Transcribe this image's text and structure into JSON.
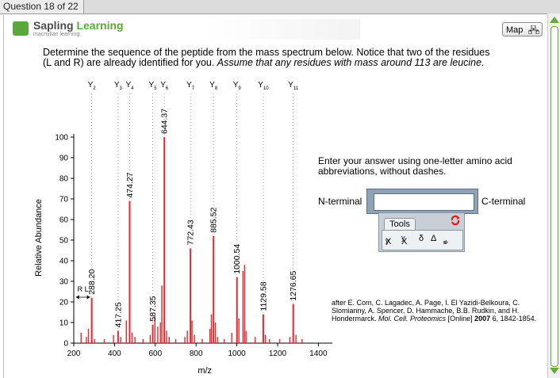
{
  "header": {
    "tab_label": "Question 18 of 22"
  },
  "logo": {
    "brand_part1": "Sapling ",
    "brand_part2": "Learning",
    "subtitle": "macmillan learning"
  },
  "map_button": {
    "label": "Map"
  },
  "prompt": {
    "line1": "Determine the sequence of the peptide from the mass spectrum below. Notice that two of the residues",
    "line2_plain": "(L and R) are already identified for you. ",
    "line2_italic": "Assume that any residues with mass around 113 are leucine."
  },
  "answer": {
    "instructions": "Enter your answer using one-letter amino acid abbreviations, without dashes.",
    "n_terminal_label": "N-terminal",
    "c_terminal_label": "C-terminal",
    "input_value": "",
    "tools_label": "Tools",
    "tool_buttons": [
      "X",
      "y",
      "X",
      "y",
      "δ",
      "Δ",
      "≤",
      "∞"
    ]
  },
  "citation": {
    "text": "after E. Com, C. Lagadec, A. Page, I. El Yazidi-Belkoura, C. Slomianny, A. Spencer, D. Hammache, B.B. Rudkin, and H. Hondermarck. ",
    "journal": "Mol. Cell. Proteomics",
    "rest1": " [Online] ",
    "year": "2007",
    "rest2": " 6, 1842-1854."
  },
  "colors": {
    "peak": "#e8282e",
    "brand_green": "#5aa73b",
    "answer_box": "#8fa3b7"
  },
  "chart_data": {
    "type": "bar",
    "xlabel": "m/z",
    "ylabel": "Relative Abundance",
    "xlim": [
      200,
      1500
    ],
    "ylim": [
      0,
      100
    ],
    "xticks": [
      200,
      400,
      600,
      800,
      1000,
      1200,
      1400
    ],
    "yticks": [
      0,
      10,
      20,
      30,
      40,
      50,
      60,
      70,
      80,
      90,
      100
    ],
    "labeled_peaks": [
      {
        "mz": 288.2,
        "label": "288.20",
        "intensity": 22
      },
      {
        "mz": 417.25,
        "label": "417.25",
        "intensity": 6
      },
      {
        "mz": 474.27,
        "label": "474.27",
        "intensity": 69
      },
      {
        "mz": 587.35,
        "label": "587.35",
        "intensity": 9
      },
      {
        "mz": 644.37,
        "label": "644.37",
        "intensity": 100
      },
      {
        "mz": 772.43,
        "label": "772.43",
        "intensity": 46
      },
      {
        "mz": 885.52,
        "label": "885.52",
        "intensity": 52
      },
      {
        "mz": 1000.54,
        "label": "1000.54",
        "intensity": 32
      },
      {
        "mz": 1129.58,
        "label": "1129.58",
        "intensity": 14
      },
      {
        "mz": 1276.65,
        "label": "1276.65",
        "intensity": 19
      }
    ],
    "minor_peaks": [
      {
        "mz": 236,
        "intensity": 5
      },
      {
        "mz": 262,
        "intensity": 3
      },
      {
        "mz": 272,
        "intensity": 7
      },
      {
        "mz": 302,
        "intensity": 2
      },
      {
        "mz": 350,
        "intensity": 2
      },
      {
        "mz": 395,
        "intensity": 4
      },
      {
        "mz": 430,
        "intensity": 3
      },
      {
        "mz": 458,
        "intensity": 11
      },
      {
        "mz": 486,
        "intensity": 5
      },
      {
        "mz": 500,
        "intensity": 3
      },
      {
        "mz": 540,
        "intensity": 2
      },
      {
        "mz": 575,
        "intensity": 4
      },
      {
        "mz": 598,
        "intensity": 13
      },
      {
        "mz": 612,
        "intensity": 8
      },
      {
        "mz": 625,
        "intensity": 10
      },
      {
        "mz": 632,
        "intensity": 28
      },
      {
        "mz": 655,
        "intensity": 6
      },
      {
        "mz": 668,
        "intensity": 3
      },
      {
        "mz": 700,
        "intensity": 2
      },
      {
        "mz": 745,
        "intensity": 3
      },
      {
        "mz": 757,
        "intensity": 6
      },
      {
        "mz": 780,
        "intensity": 11
      },
      {
        "mz": 792,
        "intensity": 4
      },
      {
        "mz": 830,
        "intensity": 2
      },
      {
        "mz": 868,
        "intensity": 7
      },
      {
        "mz": 875,
        "intensity": 14
      },
      {
        "mz": 895,
        "intensity": 10
      },
      {
        "mz": 905,
        "intensity": 3
      },
      {
        "mz": 938,
        "intensity": 2
      },
      {
        "mz": 975,
        "intensity": 5
      },
      {
        "mz": 1010,
        "intensity": 12
      },
      {
        "mz": 1030,
        "intensity": 35
      },
      {
        "mz": 1038,
        "intensity": 38
      },
      {
        "mz": 1045,
        "intensity": 6
      },
      {
        "mz": 1090,
        "intensity": 3
      },
      {
        "mz": 1140,
        "intensity": 4
      },
      {
        "mz": 1160,
        "intensity": 2
      },
      {
        "mz": 1210,
        "intensity": 2
      },
      {
        "mz": 1260,
        "intensity": 3
      },
      {
        "mz": 1290,
        "intensity": 4
      },
      {
        "mz": 1320,
        "intensity": 2
      }
    ],
    "y_ions": [
      {
        "label": "Y",
        "sub": "2",
        "mz": 288.2
      },
      {
        "label": "Y",
        "sub": "3",
        "mz": 417.25
      },
      {
        "label": "Y",
        "sub": "4",
        "mz": 474.27
      },
      {
        "label": "Y",
        "sub": "5",
        "mz": 587.35
      },
      {
        "label": "Y",
        "sub": "6",
        "mz": 644.37
      },
      {
        "label": "Y",
        "sub": "7",
        "mz": 772.43
      },
      {
        "label": "Y",
        "sub": "8",
        "mz": 885.52
      },
      {
        "label": "Y",
        "sub": "9",
        "mz": 1000.54
      },
      {
        "label": "Y",
        "sub": "10",
        "mz": 1129.58
      },
      {
        "label": "Y",
        "sub": "11",
        "mz": 1276.65
      }
    ],
    "annotations": [
      {
        "text": "R",
        "from_mz": 288.2,
        "to_mz": 288.2
      },
      {
        "text": "L",
        "from_mz": 288.2,
        "to_mz": 288.2
      }
    ]
  }
}
